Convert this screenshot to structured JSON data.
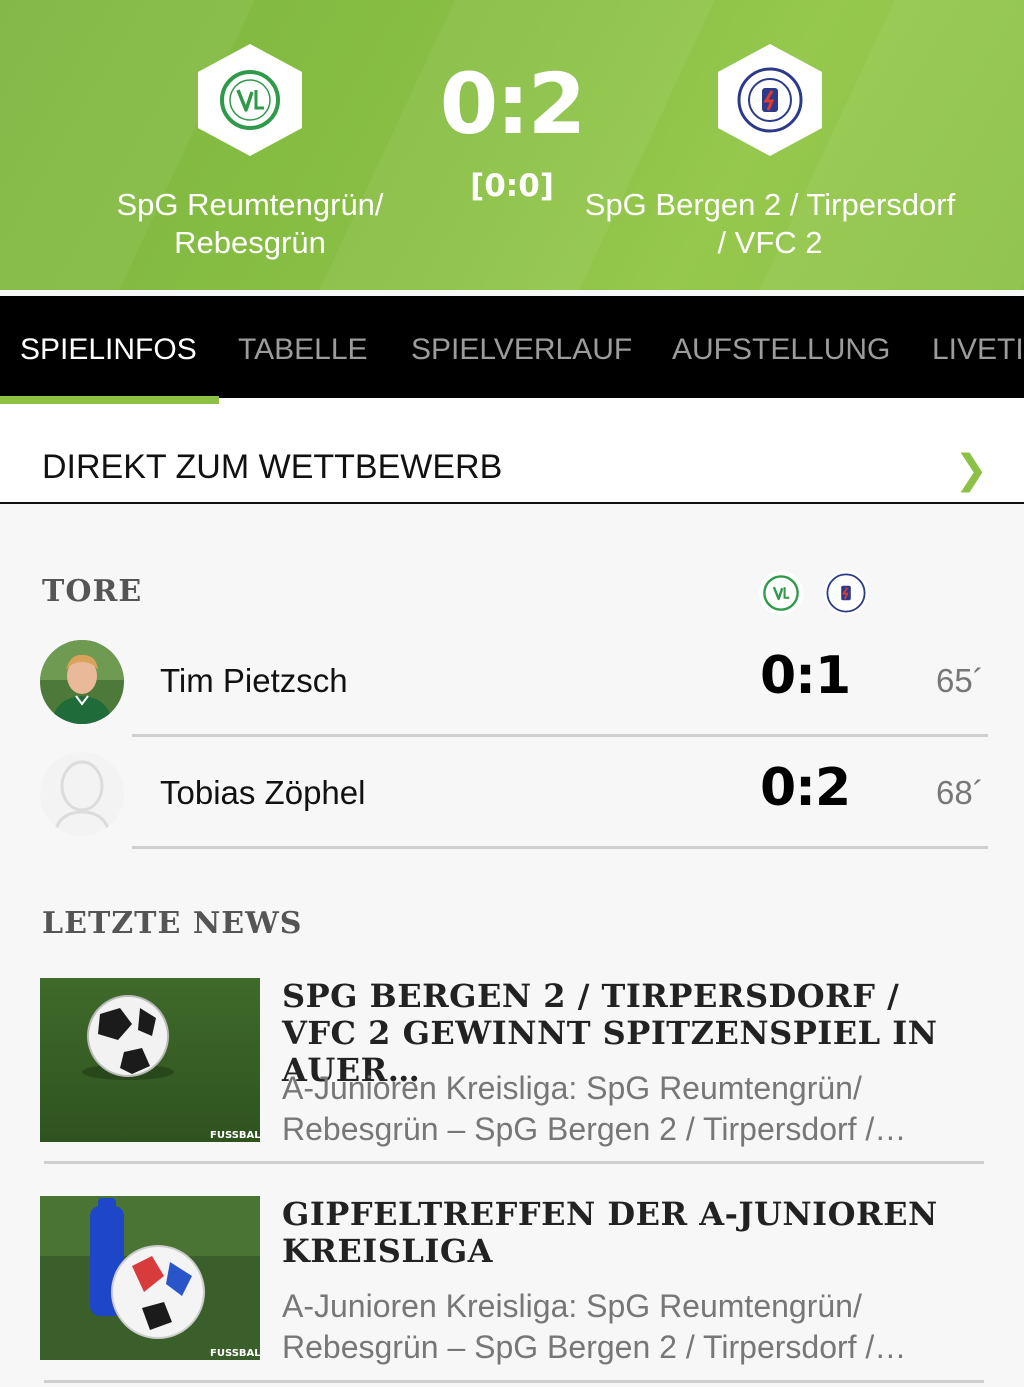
{
  "match": {
    "home_team": "SpG Reumtengrün/ Rebesgrün",
    "away_team": "SpG Bergen 2 / Tirpersdorf / VFC 2",
    "score": "0:2",
    "halftime": "[0:0]",
    "home_crest_text": "VfL",
    "away_crest_text": "SV TURBINE BERGEN e.V.",
    "colors": {
      "header_green": "#8cc146",
      "accent": "#8cc146"
    }
  },
  "tabs": [
    {
      "label": "SPIELINFOS",
      "active": true
    },
    {
      "label": "TABELLE",
      "active": false
    },
    {
      "label": "SPIELVERLAUF",
      "active": false
    },
    {
      "label": "AUFSTELLUNG",
      "active": false
    },
    {
      "label": "LIVETICKER",
      "active": false
    }
  ],
  "direct_link": {
    "label": "DIREKT ZUM WETTBEWERB",
    "icon": "chevron-right-icon"
  },
  "goals": {
    "title": "TORE",
    "items": [
      {
        "player": "Tim Pietzsch",
        "score": "0:1",
        "minute": "65´"
      },
      {
        "player": "Tobias Zöphel",
        "score": "0:2",
        "minute": "68´"
      }
    ]
  },
  "news": {
    "title": "LETZTE NEWS",
    "items": [
      {
        "title": "SPG BERGEN 2 / TIRPERSDORF / VFC 2 GEWINNT SPITZENSPIEL IN AUER…",
        "teaser": "A-Junioren Kreisliga: SpG Reumtengrün/ Rebesgrün – SpG Bergen 2 / Tirpersdorf /…",
        "watermark": "FUSSBALL"
      },
      {
        "title": "GIPFELTREFFEN DER A-JUNIOREN KREISLIGA",
        "teaser": "A-Junioren Kreisliga: SpG Reumtengrün/ Rebesgrün – SpG Bergen 2 / Tirpersdorf /…",
        "watermark": "FUSSBALL"
      }
    ]
  }
}
